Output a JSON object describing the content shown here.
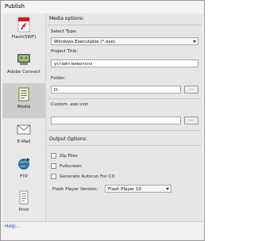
{
  "window": {
    "title": "Publish"
  },
  "sidebar": {
    "items": [
      {
        "label": "Flash(SWF)",
        "icon": "flash-swf-icon"
      },
      {
        "label": "Adobe Connect",
        "icon": "adobe-connect-icon"
      },
      {
        "label": "Media",
        "icon": "media-icon",
        "selected": true
      },
      {
        "label": "E-Mail",
        "icon": "email-icon"
      },
      {
        "label": "FTP",
        "icon": "ftp-icon"
      },
      {
        "label": "Print",
        "icon": "print-icon"
      }
    ]
  },
  "media_options": {
    "heading": "Media options:",
    "select_type_label": "Select Type:",
    "select_type_value": "Windows Executable (*.exe)",
    "project_title_label": "Project Title:",
    "project_title_value": "устайн вивоткпз",
    "folder_label": "Folder:",
    "folder_value": "D:",
    "browse_label": "...",
    "custom_icon_label": "Custom .exe icon",
    "custom_icon_value": "",
    "custom_icon_browse": "..."
  },
  "output_options": {
    "heading": "Output Options:",
    "checkboxes": [
      {
        "label": "Zip Files",
        "checked": false
      },
      {
        "label": "Fullscreen",
        "checked": false
      },
      {
        "label": "Generate Autorun For CD",
        "checked": false
      }
    ],
    "flash_player_label": "Flash Player Version:",
    "flash_player_value": "Flash Player 10"
  },
  "footer": {
    "help": "Help..."
  },
  "colors": {
    "selected_bg": "#cdcdcd",
    "flash_red": "#c8201e",
    "link_blue": "#1a4fb5"
  }
}
